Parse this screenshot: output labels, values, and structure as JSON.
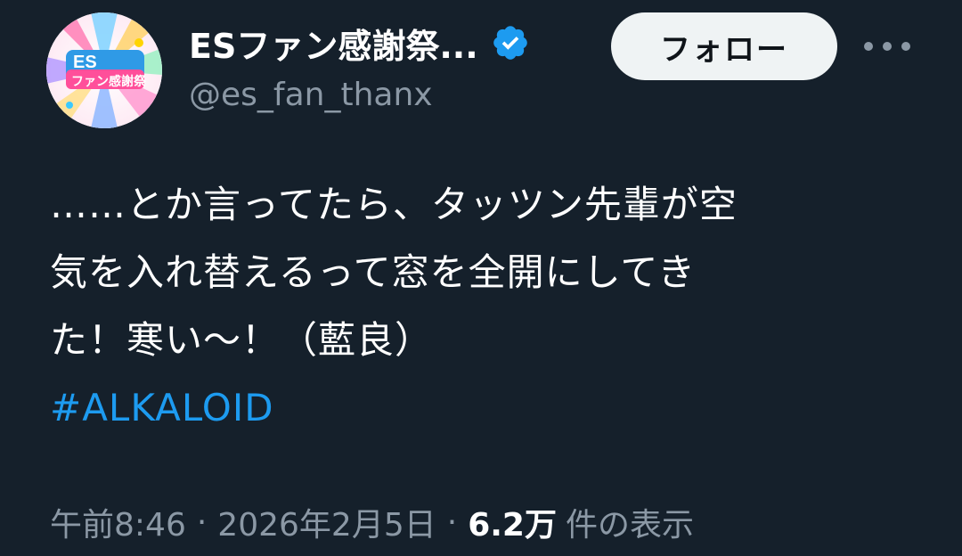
{
  "author": {
    "display_name": "ESファン感謝祭...",
    "handle": "@es_fan_thanx",
    "avatar_text": "ESファン感謝祭",
    "verified": true
  },
  "actions": {
    "follow_label": "フォロー",
    "more_icon": "more-horizontal-icon"
  },
  "tweet": {
    "lines": [
      "……とか言ってたら、タッツン先輩が空",
      "気を入れ替えるって窓を全開にしてき",
      "た！寒い〜！（藍良）"
    ],
    "hashtag": "#ALKALOID"
  },
  "meta": {
    "time": "午前8:46",
    "separator": "·",
    "date": "2026年2月5日",
    "views_count": "6.2万",
    "views_label": "件の表示"
  },
  "colors": {
    "background": "#15202b",
    "text": "#ffffff",
    "secondary_text": "#8b98a5",
    "accent": "#1d9bf0",
    "follow_button_bg": "#eff3f4"
  }
}
